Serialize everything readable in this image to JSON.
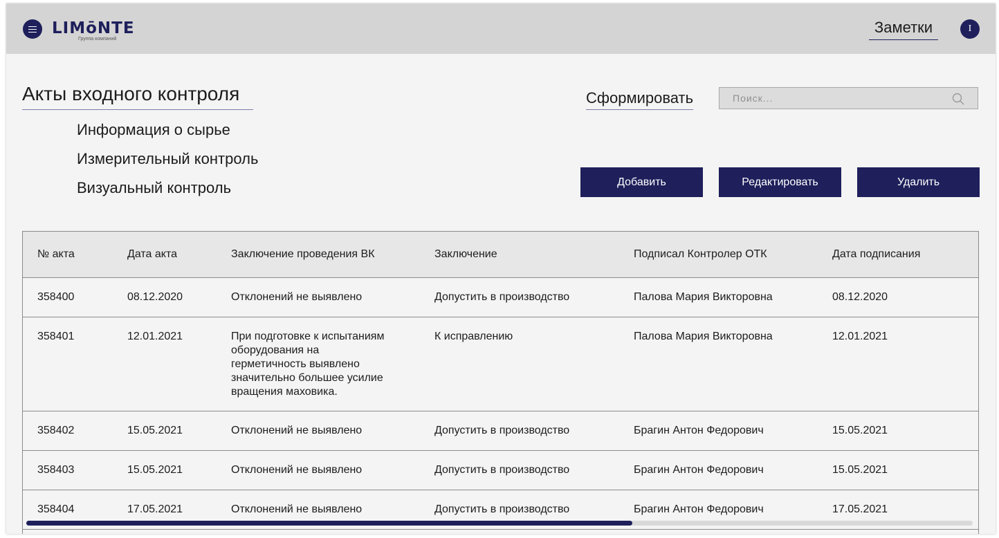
{
  "header": {
    "logo_text": "LIMōNTE",
    "logo_subtitle": "Группа компаний",
    "notes_label": "Заметки",
    "user_initial": "I"
  },
  "page": {
    "title": "Акты входного контроля",
    "subnav": [
      "Информация о сырье",
      "Измерительный контроль",
      "Визуальный контроль"
    ],
    "generate_label": "Сформировать"
  },
  "search": {
    "placeholder": "Поиск..."
  },
  "actions": {
    "add": "Добавить",
    "edit": "Редактировать",
    "delete": "Удалить"
  },
  "table": {
    "headers": [
      "№ акта",
      "Дата акта",
      "Заключение проведения ВК",
      "Заключение",
      "Подписал Контролер ОТК",
      "Дата подписания"
    ],
    "rows": [
      [
        "358400",
        "08.12.2020",
        "Отклонений не выявлено",
        "Допустить в производство",
        "Палова Мария Викторовна",
        "08.12.2020"
      ],
      [
        "358401",
        "12.01.2021",
        "При подготовке к испытаниям оборудования на герметичность выявлено значительно большее усилие вращения маховика.",
        "К исправлению",
        "Палова Мария Викторовна",
        "12.01.2021"
      ],
      [
        "358402",
        "15.05.2021",
        "Отклонений не выявлено",
        "Допустить в производство",
        "Брагин Антон Федорович",
        "15.05.2021"
      ],
      [
        "358403",
        "15.05.2021",
        "Отклонений не выявлено",
        "Допустить в производство",
        "Брагин Антон Федорович",
        "15.05.2021"
      ],
      [
        "358404",
        "17.05.2021",
        "Отклонений не выявлено",
        "Допустить в производство",
        "Брагин Антон Федорович",
        "17.05.2021"
      ]
    ]
  },
  "scroll": {
    "horizontal_position": 0.64
  },
  "colors": {
    "accent": "#1e1f5b",
    "header_bg": "#d4d4d4",
    "page_bg": "#f4f4f4"
  }
}
